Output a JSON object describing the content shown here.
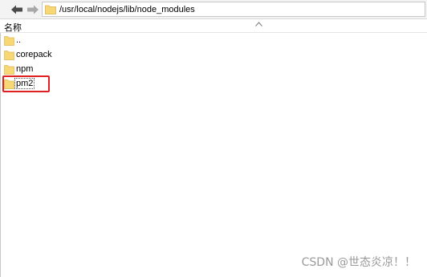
{
  "address": {
    "path": "/usr/local/nodejs/lib/node_modules"
  },
  "columns": {
    "name": "名称"
  },
  "files": [
    {
      "label": ".."
    },
    {
      "label": "corepack"
    },
    {
      "label": "npm"
    },
    {
      "label": "pm2",
      "selected": true
    }
  ],
  "watermark": "CSDN @世态炎凉！！",
  "colors": {
    "folder": "#f8d775",
    "highlight": "#e02020",
    "arrow": "#5a5a5a"
  },
  "icons": {
    "back": "back-arrow-icon",
    "forward": "forward-arrow-icon",
    "folder": "folder-icon",
    "sort": "sort-up-icon"
  }
}
